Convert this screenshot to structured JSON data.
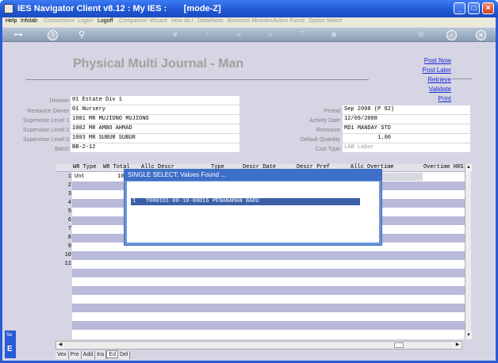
{
  "window": {
    "title": "IES Navigator Client v8.12 : My IES :       [mode-Z]",
    "buttons": {
      "minimize": "_",
      "maximize": "□",
      "close": "×"
    }
  },
  "menu": {
    "items": [
      {
        "label": "Help",
        "enabled": true
      },
      {
        "label": "Infolab",
        "enabled": true
      },
      {
        "label": "Connections",
        "enabled": false
      },
      {
        "label": "Logon",
        "enabled": false
      },
      {
        "label": "Logoff",
        "enabled": true
      },
      {
        "label": "Companion",
        "enabled": false
      },
      {
        "label": "Wizard",
        "enabled": false
      },
      {
        "label": "How do I",
        "enabled": false
      },
      {
        "label": "DataMarts",
        "enabled": false
      },
      {
        "label": "Business Modules",
        "enabled": false
      },
      {
        "label": "Action Focus",
        "enabled": false
      },
      {
        "label": "Option Select",
        "enabled": false
      }
    ]
  },
  "toolbar": {
    "icons": [
      "key-icon",
      "help-icon",
      "search-icon",
      "heart-icon",
      "history-icon",
      "back-icon",
      "forward-icon",
      "pin-icon",
      "stop-icon",
      "settings-icon",
      "check-icon",
      "close-icon"
    ],
    "glyphs": [
      "⊶",
      "?",
      "⚲",
      "♥",
      "◔",
      "«",
      "»",
      "⊤",
      "■",
      "✻",
      "✓",
      "✕"
    ]
  },
  "page": {
    "title": "Physical Multi Journal - Man",
    "actions": [
      "Post Now",
      "Post Later",
      "Retrieve",
      "Validate",
      "Print"
    ]
  },
  "fields_left": [
    {
      "label": "Division",
      "value": "01 Estate Div 1"
    },
    {
      "label": "Resource Owner",
      "value": "01 Nursery"
    },
    {
      "label": "Supervisor Level 1",
      "value": "1001 MR MUJIONO MUJIONO"
    },
    {
      "label": "Supervisor Level 2",
      "value": "1002 MR AMBO AHMAD"
    },
    {
      "label": "Supervisor Level 3",
      "value": "1003 MR SUBUR SUBUR"
    },
    {
      "label": "Batch",
      "value": "BB-2-12"
    }
  ],
  "fields_right": [
    {
      "label": "Period",
      "value": "Sep 2008 (P 92)"
    },
    {
      "label": "Activity Date",
      "value": "12/09/2008"
    },
    {
      "label": "Resource",
      "value": "MD1 MANDAY STD"
    },
    {
      "label": "Default Quantity",
      "value": "1.00"
    },
    {
      "label": "Cost Type",
      "value": "LAB Labor"
    }
  ],
  "grid": {
    "headers": [
      "WR Type",
      "WR Total",
      "Allc Descr",
      "Type",
      "Descr Date",
      "Descr Pref",
      "Allc Overtime",
      "Overtime HRS"
    ],
    "row_numbers": [
      "1",
      "2",
      "3",
      "4",
      "5",
      "6",
      "7",
      "8",
      "9",
      "10",
      "11"
    ],
    "first_row": {
      "wr_type": "Unt",
      "wr_total": "10"
    }
  },
  "tabs": [
    "Vex",
    "Pre",
    "Add",
    "Ins",
    "Ed",
    "Del"
  ],
  "side_label": "Se",
  "dialog": {
    "title": "SINGLE SELECT: Values Found ...",
    "rows": [
      {
        "index": "1",
        "code": "Y000101-00-10-00016",
        "name": "PENANAMAN BARU"
      }
    ]
  }
}
